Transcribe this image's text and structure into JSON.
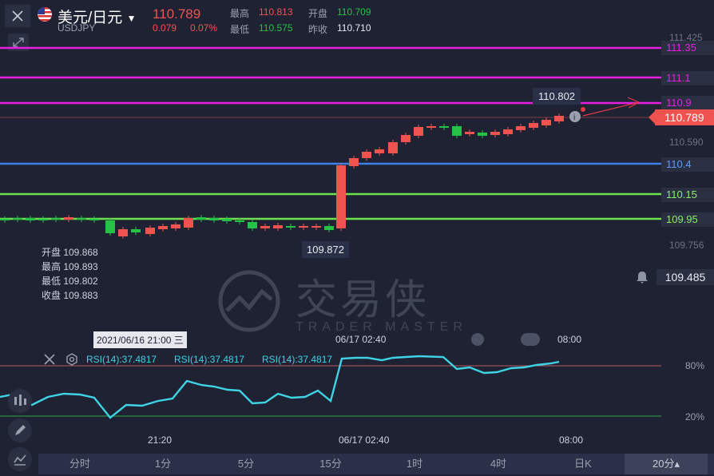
{
  "header": {
    "symbol": "美元/日元",
    "symbol_code": "USDJPY",
    "price": "110.789",
    "change": "0.079",
    "change_pct": "0.07%",
    "high_label": "最高",
    "high_value": "110.813",
    "open_label": "开盘",
    "open_value": "110.709",
    "low_label": "最低",
    "low_value": "110.575",
    "prev_close_label": "昨收",
    "prev_close_value": "110.710"
  },
  "price_axis": [
    "111.425",
    "110.590",
    "109.756"
  ],
  "levels": [
    {
      "value": "111.35",
      "color": "#e91ee3"
    },
    {
      "value": "111.1",
      "color": "#e91ee3"
    },
    {
      "value": "110.9",
      "color": "#e91ee3"
    },
    {
      "value": "110.4",
      "color": "#3f7fe8"
    },
    {
      "value": "110.15",
      "color": "#6ee04d"
    },
    {
      "value": "109.95",
      "color": "#6ee04d"
    }
  ],
  "current_price_tag": "110.789",
  "alert_price": "109.485",
  "high_tooltip": "110.802",
  "low_tooltip": "109.872",
  "ohlc_panel": {
    "open": "开盘 109.868",
    "high": "最高 109.893",
    "low": "最低 109.802",
    "close": "收盘 109.883"
  },
  "crosshair_date": "2021/06/16 21:00 三",
  "top_time_labels": [
    "06/17 02:40",
    "08:00"
  ],
  "watermark": {
    "cn": "交易侠",
    "en": "TRADER MASTER"
  },
  "rsi": {
    "labels": [
      "RSI(14):37.4817",
      "RSI(14):37.4817",
      "RSI(14):37.4817"
    ],
    "levels": [
      "80%",
      "20%"
    ]
  },
  "x_axis": [
    "21:20",
    "06/17 02:40",
    "08:00"
  ],
  "timeframes": [
    "分时",
    "1分",
    "5分",
    "15分",
    "1时",
    "4时",
    "日K",
    "20分▴"
  ],
  "colors": {
    "up": "#ef5350",
    "down": "#26c245",
    "bg": "#1e2233",
    "rsi": "#3fd3e6"
  }
}
